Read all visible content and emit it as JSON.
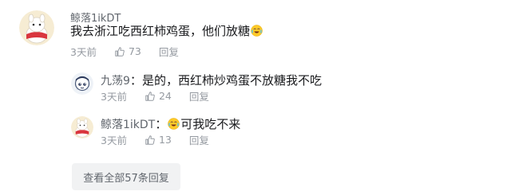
{
  "comment": {
    "username": "鲸落1ikDT",
    "text": "我去浙江吃西红柿鸡蛋，他们放糖",
    "emoji": "laugh-cry-emoji",
    "time": "3天前",
    "likes": "73",
    "reply": "回复"
  },
  "replies": [
    {
      "username": "九荡9",
      "separator": "：",
      "text": "是的，西红柿炒鸡蛋不放糖我不吃",
      "time": "3天前",
      "likes": "24",
      "reply": "回复"
    },
    {
      "username": "鲸落1ikDT",
      "separator": "：",
      "emoji": "laugh-cry-emoji",
      "text": "可我吃不来",
      "time": "3天前",
      "likes": "13",
      "reply": "回复"
    }
  ],
  "view_all": "查看全部57条回复",
  "colors": {
    "username": "#61666d",
    "text": "#18191c",
    "meta": "#9499a0",
    "button_bg": "#f1f2f3"
  }
}
